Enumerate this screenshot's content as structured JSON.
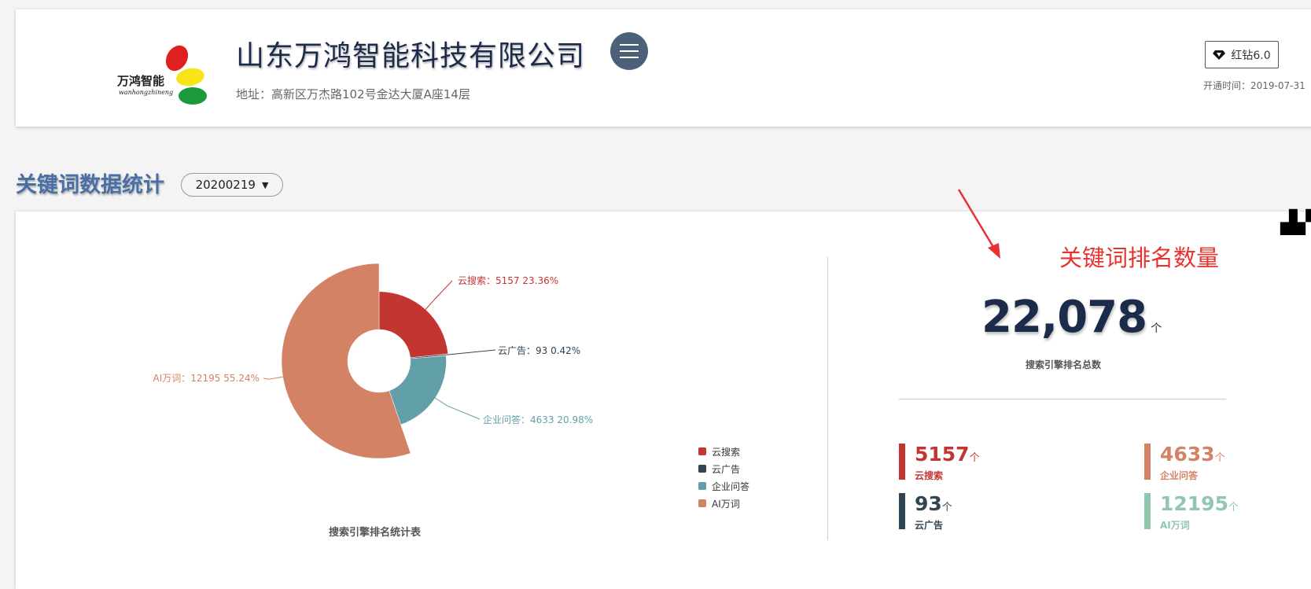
{
  "header": {
    "logo_text": "万鸿智能",
    "logo_pinyin": "wanhongzhineng",
    "company_name": "山东万鸿智能科技有限公司",
    "address": "地址：高新区万杰路102号金达大厦A座14层",
    "vip_label": "红钻6.0",
    "open_time": "开通时间：2019-07-31"
  },
  "section": {
    "title": "关键词数据统计",
    "date_value": "20200219"
  },
  "annotation": {
    "text": "关键词排名数量"
  },
  "colors": {
    "cloud_search": "#c23531",
    "cloud_ad": "#2f4554",
    "enterprise_qa": "#61a0a8",
    "ai_words": "#d48265",
    "ai_words_stat": "#91c7ae",
    "title_blue": "#4a6fa5",
    "dark_navy": "#1d2b4a"
  },
  "chart_data": {
    "type": "pie",
    "title": "搜索引擎排名统计表",
    "series": [
      {
        "name": "云搜索",
        "value": 5157,
        "percent": "23.36%",
        "label": "云搜索：5157    23.36%"
      },
      {
        "name": "云广告",
        "value": 93,
        "percent": "0.42%",
        "label": "云广告：93    0.42%"
      },
      {
        "name": "企业问答",
        "value": 4633,
        "percent": "20.98%",
        "label": "企业问答：4633    20.98%"
      },
      {
        "name": "AI万词",
        "value": 12195,
        "percent": "55.24%",
        "label": "AI万词：12195    55.24%"
      }
    ],
    "legend": [
      "云搜索",
      "云广告",
      "企业问答",
      "AI万词"
    ],
    "legend_position": "bottom-right",
    "style": "rose-donut"
  },
  "totals": {
    "total": "22,078",
    "unit": "个",
    "caption": "搜索引擎排名总数"
  },
  "stats": [
    {
      "value": "5157",
      "unit": "个",
      "label": "云搜索",
      "color": "#c23531"
    },
    {
      "value": "4633",
      "unit": "个",
      "label": "企业问答",
      "color": "#d48265"
    },
    {
      "value": "93",
      "unit": "个",
      "label": "云广告",
      "color": "#2f4554"
    },
    {
      "value": "12195",
      "unit": "个",
      "label": "AI万词",
      "color": "#91c7ae"
    }
  ]
}
